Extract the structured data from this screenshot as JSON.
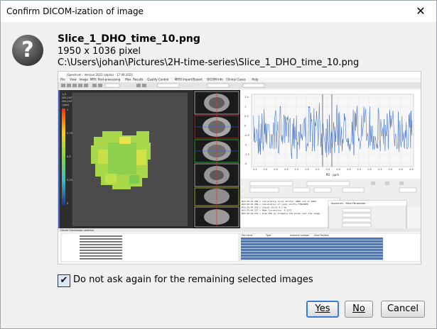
{
  "dialog": {
    "title": "Confirm DICOM-ization of image",
    "close_glyph": "✕",
    "icon": "question-icon",
    "icon_glyph": "?",
    "filename": "Slice_1_DHO_time_10.png",
    "dimensions": "1950 x 1036 pixel",
    "path": "C:\\Users\\johan\\Pictures\\2H-time-series\\Slice_1_DHO_time_10.png",
    "checkbox": {
      "label": "Do not ask again for the remaining selected images",
      "checked": true,
      "mark": "✔"
    },
    "buttons": {
      "yes": "Yes",
      "no": "No",
      "cancel": "Cancel"
    }
  },
  "preview": {
    "window_title": "jSpectrum - Version 2021 (alpha) - 17.09.2021",
    "menu": [
      "File",
      "View",
      "Image",
      "MRS",
      "Post-processing",
      "Max",
      "Results",
      "Quality Control",
      "MRSI Import/Export",
      "DICOM Info",
      "Clinical Cases",
      "Help"
    ],
    "chart_axis_label": "PD - ppm",
    "chart_data": {
      "type": "line",
      "x_tick_labels": [
        "2.5",
        "2.5",
        "2.5",
        "2.5",
        "2.5",
        "2.5",
        "2.5",
        "2.5",
        "2.5",
        "2.5",
        "2.5",
        "2.5",
        "2.5",
        "2.5",
        "2.5",
        "2.5"
      ],
      "y_tick_labels": [
        "1.5",
        "1",
        "0.5",
        "0",
        "-0.5",
        "-1",
        "-1.5",
        "-2"
      ],
      "xlabel": "PD - ppm"
    },
    "colorbar_labels": [
      "1",
      "0.75",
      "0.5",
      "0.25",
      "0"
    ],
    "log_lines": [
      "#16:22:44.099 > Calculating local shifts: 4086 out of 4086",
      "#16:22:44.209 > Calculation of local shifts FINISHED",
      "#16:22:44.218 > Visual Shift 0.1 ms",
      "#16:22:44.227 > Mean Correction: 0.1273",
      "#16:22:44.232 > Draw ROI by dragging the mouse over the image"
    ],
    "panel_labels": {
      "table_title": "Dicom Filechooser selector",
      "table_headers": [
        "File name",
        "Type",
        "Instance number",
        "Slice Position"
      ],
      "popup_title": "Spectrum - Filter Parameter"
    }
  }
}
